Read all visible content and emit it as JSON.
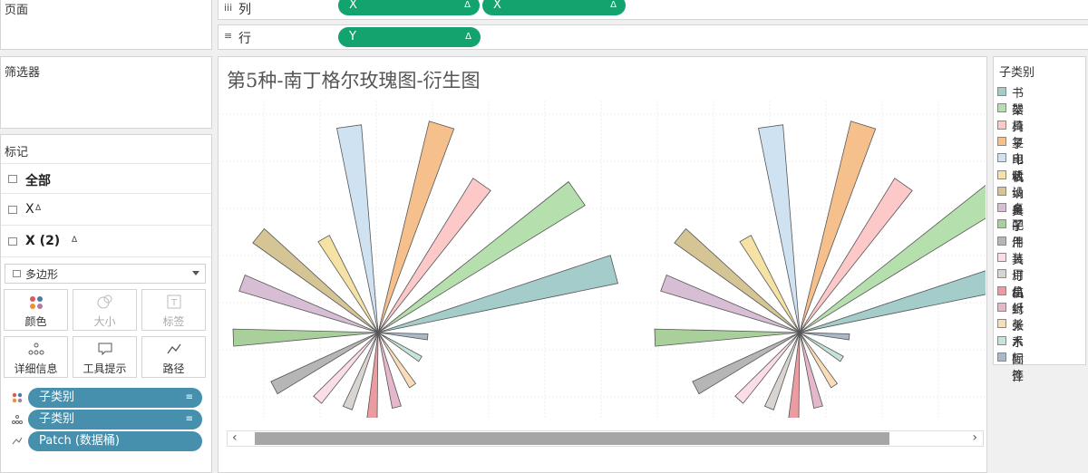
{
  "sidebar": {
    "pages_label": "页面",
    "filters_label": "筛选器",
    "marks_label": "标记",
    "mark_rows": [
      {
        "label": "全部"
      },
      {
        "label": "X",
        "delta": "Δ"
      },
      {
        "label": "X (2)",
        "delta": "Δ"
      }
    ],
    "mark_type": "多边形",
    "buttons": {
      "color": "颜色",
      "size": "大小",
      "label": "标签",
      "detail": "详细信息",
      "tooltip": "工具提示",
      "path": "路径"
    },
    "fields": [
      {
        "name": "子类别",
        "icon": "color-dots-icon"
      },
      {
        "name": "子类别",
        "icon": "detail-dots-icon"
      },
      {
        "name": "Patch (数据桶)",
        "icon": "path-icon"
      }
    ]
  },
  "shelves": {
    "columns_label": "列",
    "rows_label": "行",
    "columns_pills": [
      {
        "name": "X",
        "delta": "Δ"
      },
      {
        "name": "X",
        "delta": "Δ"
      }
    ],
    "rows_pills": [
      {
        "name": "Y",
        "delta": "Δ"
      }
    ]
  },
  "view": {
    "title": "第5种-南丁格尔玫瑰图-衍生图",
    "scroll_left": "‹",
    "scroll_right": "›"
  },
  "legend": {
    "title": "子类别",
    "items": [
      {
        "label": "书架",
        "color": "#a3cccb"
      },
      {
        "label": "器具",
        "color": "#b5dfac"
      },
      {
        "label": "椅子",
        "color": "#fcc9c8"
      },
      {
        "label": "复印机",
        "color": "#f6c08c"
      },
      {
        "label": "电话",
        "color": "#cfe2f2"
      },
      {
        "label": "收纳具",
        "color": "#f7e2a6"
      },
      {
        "label": "设备",
        "color": "#d5c595"
      },
      {
        "label": "桌子",
        "color": "#d7bed4"
      },
      {
        "label": "配件",
        "color": "#a9cf9b"
      },
      {
        "label": "用具",
        "color": "#b6b6b6"
      },
      {
        "label": "装订机",
        "color": "#fbdde5"
      },
      {
        "label": "用品",
        "color": "#d8d5d1"
      },
      {
        "label": "信封",
        "color": "#ec9ca1"
      },
      {
        "label": "纸张",
        "color": "#e4b7cb"
      },
      {
        "label": "美术",
        "color": "#f9dcb9"
      },
      {
        "label": "系固件",
        "color": "#c6e2d9"
      },
      {
        "label": "标签",
        "color": "#a9b9c9"
      }
    ]
  },
  "chart_data": {
    "type": "polar-area",
    "categories": [
      "书架",
      "器具",
      "椅子",
      "复印机",
      "电话",
      "收纳具",
      "设备",
      "桌子",
      "配件",
      "用具",
      "装订机",
      "用品",
      "信封",
      "纸张",
      "美术",
      "系固件",
      "标签"
    ],
    "series": [
      {
        "angles_deg": [
          15,
          35,
          55,
          73,
          98,
          120,
          141,
          160,
          182,
          208,
          228,
          248,
          266,
          284,
          303,
          328,
          355
        ],
        "radii": [
          270,
          268,
          200,
          240,
          230,
          120,
          170,
          160,
          160,
          130,
          100,
          90,
          95,
          85,
          70,
          55,
          55
        ]
      },
      {
        "angles_deg": [
          15,
          35,
          55,
          73,
          98,
          120,
          141,
          160,
          182,
          208,
          228,
          248,
          266,
          284,
          303,
          328,
          355
        ],
        "radii": [
          270,
          268,
          200,
          240,
          230,
          120,
          170,
          160,
          160,
          130,
          100,
          90,
          95,
          85,
          70,
          55,
          55
        ]
      }
    ]
  }
}
